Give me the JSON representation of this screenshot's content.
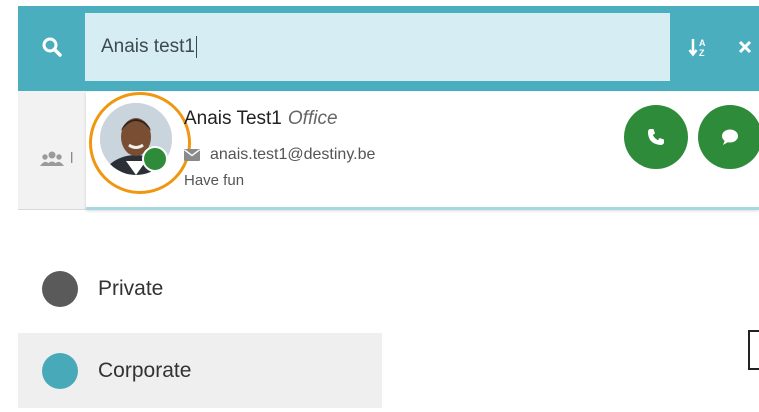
{
  "search": {
    "value": "Anais test1",
    "colors": {
      "bar": "#4aaebf",
      "field": "#d6eef3"
    }
  },
  "background": {
    "label_fragment": "l"
  },
  "result": {
    "name": "Anais Test1",
    "type": "Office",
    "email": "anais.test1@destiny.be",
    "status_message": "Have fun",
    "presence_color": "#2e8b3a",
    "highlight_ring_color": "#f0960f",
    "icons": [
      "avatar",
      "presence-dot",
      "envelope-icon",
      "phone-icon",
      "chat-icon"
    ]
  },
  "menu": {
    "items": [
      {
        "label": "Private",
        "color": "#5a5a5a"
      },
      {
        "label": "Corporate",
        "color": "#48a9b9"
      }
    ]
  },
  "icons": {
    "search": "search-icon",
    "sort": "sort-icon",
    "close": "close-icon",
    "users": "users-icon"
  }
}
